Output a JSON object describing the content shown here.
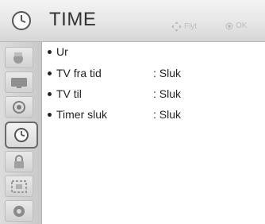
{
  "header": {
    "title": "TIME",
    "hint_move": "Flyt",
    "hint_ok": "OK",
    "icon": "clock-icon"
  },
  "sidebar": {
    "items": [
      {
        "icon": "image-icon"
      },
      {
        "icon": "monitor-icon"
      },
      {
        "icon": "speaker-icon"
      },
      {
        "icon": "clock-icon",
        "active": true
      },
      {
        "icon": "lock-icon"
      },
      {
        "icon": "settings-board-icon"
      },
      {
        "icon": "support-icon"
      }
    ]
  },
  "menu": {
    "items": [
      {
        "label": "Ur",
        "value": ""
      },
      {
        "label": "TV fra tid",
        "value": ": Sluk"
      },
      {
        "label": "TV til",
        "value": ": Sluk"
      },
      {
        "label": "Timer sluk",
        "value": ": Sluk"
      }
    ]
  },
  "colors": {
    "header_bg": "#e6e6e6",
    "sidebar_bg": "#d2d2d2",
    "text": "#222222",
    "hint": "#bdbdbd"
  }
}
